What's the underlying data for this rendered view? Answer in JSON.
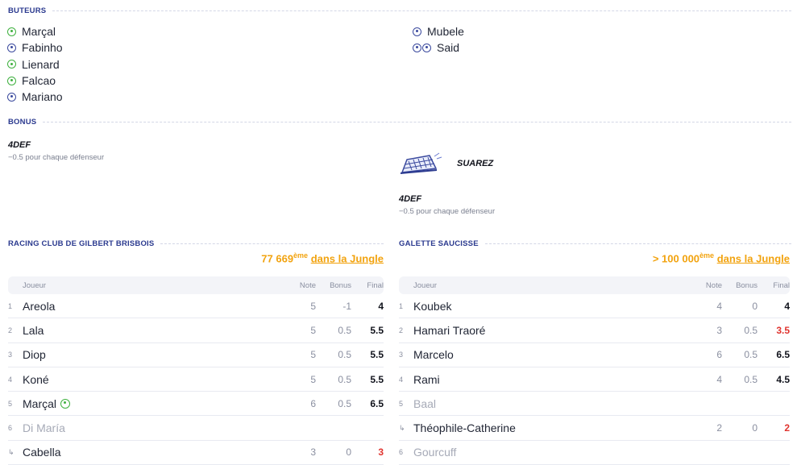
{
  "scorers_section": {
    "title": "BUTEURS",
    "left": [
      {
        "name": "Marçal",
        "icon": "green-ball-icon"
      },
      {
        "name": "Fabinho",
        "icon": "blue-ball-icon"
      },
      {
        "name": "Lienard",
        "icon": "green-ball-icon"
      },
      {
        "name": "Falcao",
        "icon": "green-ball-icon"
      },
      {
        "name": "Mariano",
        "icon": "blue-ball-icon"
      }
    ],
    "right": [
      {
        "name": "Mubele",
        "icon": "blue-ball-icon"
      },
      {
        "name": "Said",
        "icon": "two-blue-balls-icon"
      }
    ]
  },
  "bonus_section": {
    "title": "BONUS",
    "left": {
      "name": "4DEF",
      "desc": "−0.5 pour chaque défenseur"
    },
    "right": {
      "badge": "SUAREZ",
      "name": "4DEF",
      "desc": "−0.5 pour chaque défenseur"
    }
  },
  "team_left": {
    "name": "RACING CLUB DE GILBERT BRISBOIS",
    "rank": "77 669",
    "rank_suffix": "ème",
    "rank_link": "dans la Jungle",
    "headers": {
      "player": "Joueur",
      "note": "Note",
      "bonus": "Bonus",
      "final": "Final"
    },
    "rows": [
      {
        "idx": "1",
        "name": "Areola",
        "note": "5",
        "bonus": "-1",
        "final": "4"
      },
      {
        "idx": "2",
        "name": "Lala",
        "note": "5",
        "bonus": "0.5",
        "final": "5.5"
      },
      {
        "idx": "3",
        "name": "Diop",
        "note": "5",
        "bonus": "0.5",
        "final": "5.5"
      },
      {
        "idx": "4",
        "name": "Koné",
        "note": "5",
        "bonus": "0.5",
        "final": "5.5"
      },
      {
        "idx": "5",
        "name": "Marçal",
        "note": "6",
        "bonus": "0.5",
        "final": "6.5"
      },
      {
        "idx": "6",
        "name": "Di María",
        "note": "",
        "bonus": "",
        "final": ""
      },
      {
        "idx": "",
        "name": "Cabella",
        "note": "3",
        "bonus": "0",
        "final": "3"
      }
    ]
  },
  "team_right": {
    "name": "GALETTE SAUCISSE",
    "rank": "> 100 000",
    "rank_suffix": "ème",
    "rank_link": "dans la Jungle",
    "headers": {
      "player": "Joueur",
      "note": "Note",
      "bonus": "Bonus",
      "final": "Final"
    },
    "rows": [
      {
        "idx": "1",
        "name": "Koubek",
        "note": "4",
        "bonus": "0",
        "final": "4"
      },
      {
        "idx": "2",
        "name": "Hamari Traoré",
        "note": "3",
        "bonus": "0.5",
        "final": "3.5"
      },
      {
        "idx": "3",
        "name": "Marcelo",
        "note": "6",
        "bonus": "0.5",
        "final": "6.5"
      },
      {
        "idx": "4",
        "name": "Rami",
        "note": "4",
        "bonus": "0.5",
        "final": "4.5"
      },
      {
        "idx": "5",
        "name": "Baal",
        "note": "",
        "bonus": "",
        "final": ""
      },
      {
        "idx": "",
        "name": "Théophile-Catherine",
        "note": "2",
        "bonus": "0",
        "final": "2"
      },
      {
        "idx": "6",
        "name": "Gourcuff",
        "note": "",
        "bonus": "",
        "final": ""
      }
    ]
  },
  "colors": {
    "accent_blue": "#2b3a8f",
    "rank_orange": "#f2a30f",
    "bad_red": "#e0342f",
    "goal_green": "#3fb13f"
  }
}
